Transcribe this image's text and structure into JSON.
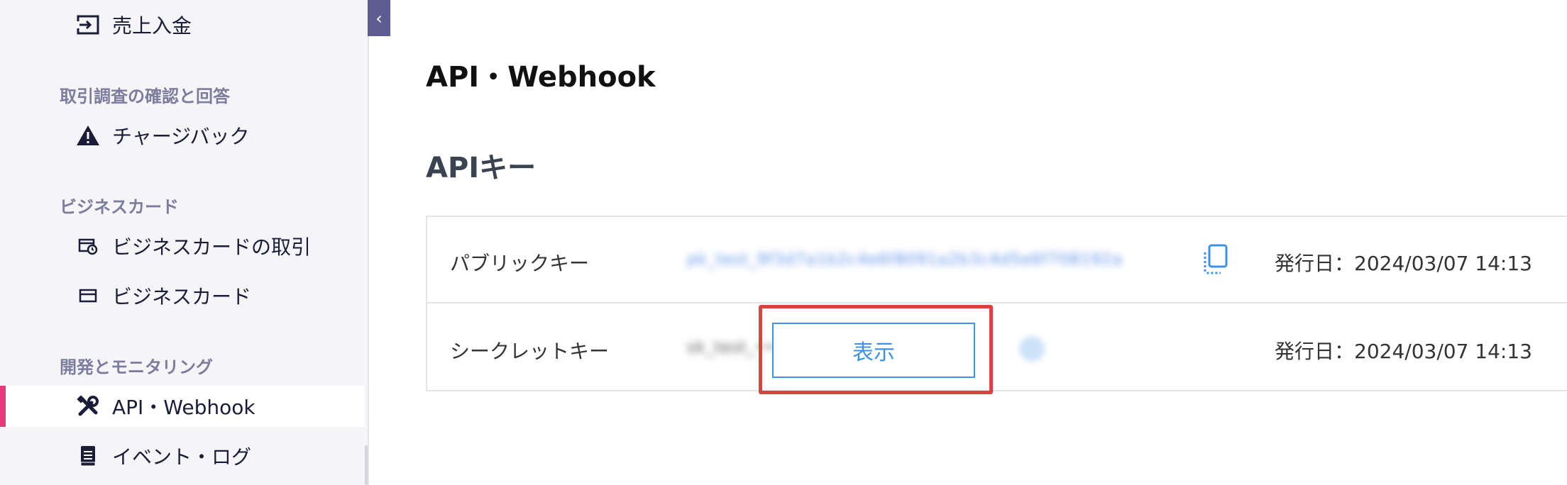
{
  "sidebar": {
    "collapse_symbol": "‹",
    "items_top": [
      {
        "label": "売上入金",
        "icon": "deposit-icon"
      }
    ],
    "sections": [
      {
        "title": "取引調査の確認と回答",
        "items": [
          {
            "label": "チャージバック",
            "icon": "warning-icon"
          }
        ]
      },
      {
        "title": "ビジネスカード",
        "items": [
          {
            "label": "ビジネスカードの取引",
            "icon": "card-history-icon"
          },
          {
            "label": "ビジネスカード",
            "icon": "card-icon"
          }
        ]
      },
      {
        "title": "開発とモニタリング",
        "items": [
          {
            "label": "API・Webhook",
            "icon": "tools-icon",
            "active": true
          },
          {
            "label": "イベント・ログ",
            "icon": "log-icon"
          }
        ]
      }
    ]
  },
  "main": {
    "page_title": "API・Webhook",
    "section_heading": "APIキー",
    "keys": [
      {
        "label": "パブリックキー",
        "value": "pk_test_9f3d7a1b2c4e6f8091a2b3c4d5e6f708192a",
        "issued": "発行日：2024/03/07 14:13"
      },
      {
        "label": "シークレットキー",
        "value": "sk_test_••••••••••••••••••••",
        "issued": "発行日：2024/03/07 14:13"
      }
    ],
    "show_button_label": "表示"
  },
  "colors": {
    "accent": "#3d92e8",
    "active_marker": "#e8397b",
    "highlight": "#d9443f",
    "sidebar_bg": "#f5f5f8",
    "collapse_bg": "#5c5b92"
  }
}
